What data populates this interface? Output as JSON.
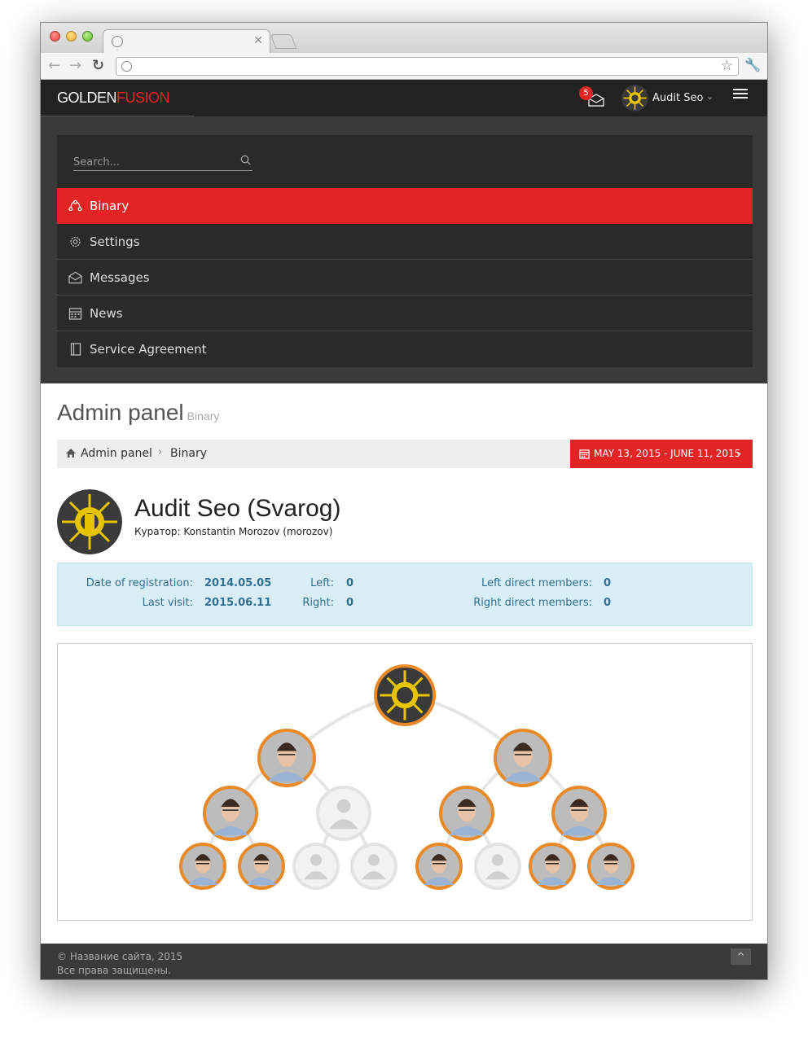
{
  "app": {
    "logo_part1": "GOLDEN",
    "logo_part2": "FUSION",
    "mail_count": "5",
    "user_name": "Audit Seo"
  },
  "search": {
    "placeholder": "Search..."
  },
  "menu": {
    "items": [
      {
        "label": "Binary",
        "icon": "binary-tree-icon",
        "active": true
      },
      {
        "label": "Settings",
        "icon": "gear-icon",
        "active": false
      },
      {
        "label": "Messages",
        "icon": "envelope-icon",
        "active": false
      },
      {
        "label": "News",
        "icon": "calendar-icon",
        "active": false
      },
      {
        "label": "Service Agreement",
        "icon": "notebook-icon",
        "active": false
      }
    ]
  },
  "page": {
    "title": "Admin panel",
    "subtitle": "Binary"
  },
  "breadcrumb": {
    "home": "Admin panel",
    "current": "Binary",
    "date_range": "MAY 13, 2015 - JUNE 11, 2015"
  },
  "profile": {
    "name": "Audit Seo (Svarog)",
    "curator": "Куратор: Konstantin Morozov (morozov)"
  },
  "stats": {
    "reg_label": "Date of registration:",
    "reg_value": "2014.05.05",
    "visit_label": "Last visit:",
    "visit_value": "2015.06.11",
    "left_label": "Left:",
    "left_value": "0",
    "right_label": "Right:",
    "right_value": "0",
    "left_direct_label": "Left direct members:",
    "left_direct_value": "0",
    "right_direct_label": "Right direct members:",
    "right_direct_value": "0"
  },
  "tree": {
    "root": "emblem",
    "level1": [
      "person",
      "person"
    ],
    "level2": [
      "person",
      "empty",
      "person",
      "person"
    ],
    "level3": [
      "person",
      "person",
      "empty",
      "empty",
      "person",
      "empty",
      "person",
      "person"
    ],
    "colors": {
      "filled_border": "#e98a2a",
      "empty_border": "#e3e3e3",
      "line": "#e6e6e6"
    }
  },
  "footer": {
    "line1": "© Название сайта, 2015",
    "line2": "Все права защищены."
  },
  "colors": {
    "accent": "#e22424",
    "header": "#222222",
    "info_bg": "#d9edf7"
  }
}
